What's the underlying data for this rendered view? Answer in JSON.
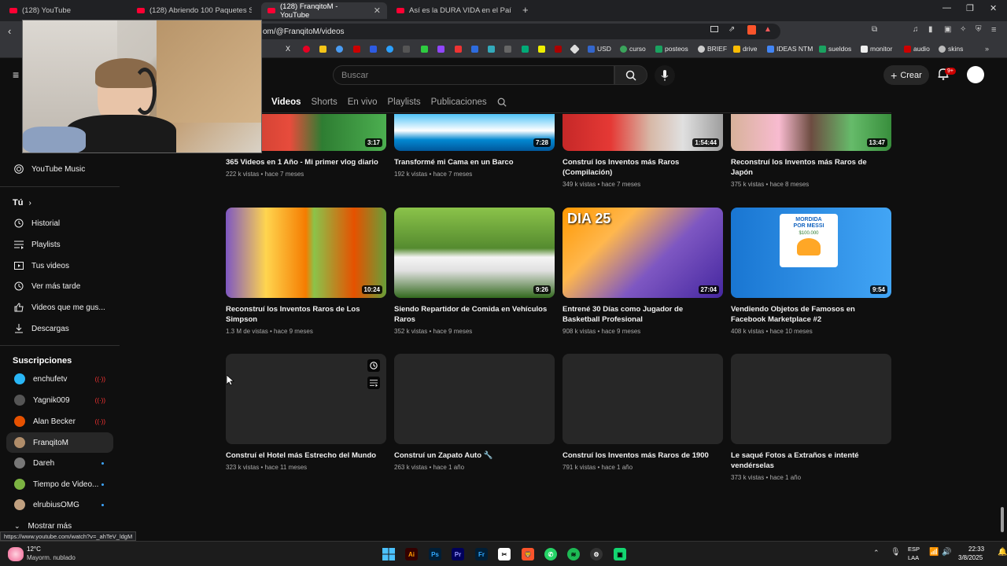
{
  "browser": {
    "tabs": [
      {
        "title": "(128) YouTube"
      },
      {
        "title": "(128) Abriendo 100 Paquetes Sorpre..."
      },
      {
        "title": "(128) FranqitoM - YouTube"
      },
      {
        "title": "Así es la DURA VIDA en el País Más B..."
      }
    ],
    "url": "om/@FranqitoM/videos",
    "bookmarks": [
      "USD",
      "curso",
      "posteos",
      "BRIEF",
      "drive",
      "IDEAS NTM",
      "sueldos",
      "monitor",
      "audio",
      "skins"
    ]
  },
  "header": {
    "search_placeholder": "Buscar",
    "create_label": "Crear",
    "notif_count": "9+"
  },
  "channel_tabs": [
    "Videos",
    "Shorts",
    "En vivo",
    "Playlists",
    "Publicaciones"
  ],
  "sidebar": {
    "music": "YouTube Music",
    "you_header": "Tú",
    "you_items": [
      "Historial",
      "Playlists",
      "Tus videos",
      "Ver más tarde",
      "Videos que me gus...",
      "Descargas"
    ],
    "subs_header": "Suscripciones",
    "subs": [
      {
        "name": "enchufetv"
      },
      {
        "name": "Yagnik009"
      },
      {
        "name": "Alan Becker"
      },
      {
        "name": "FranqitoM"
      },
      {
        "name": "Dareh"
      },
      {
        "name": "Tiempo de Video..."
      },
      {
        "name": "elrubiusOMG"
      }
    ],
    "more": "Mostrar más"
  },
  "videos": [
    {
      "title": "365 Videos en 1 Año - Mi primer vlog diario",
      "meta": "222 k vistas • hace 7 meses",
      "duration": "3:17"
    },
    {
      "title": "Transformé mi Cama en un Barco",
      "meta": "192 k vistas • hace 7 meses",
      "duration": "7:28"
    },
    {
      "title": "Construí los Inventos más Raros (Compilación)",
      "meta": "349 k vistas • hace 7 meses",
      "duration": "1:54:44"
    },
    {
      "title": "Reconstruí los Inventos más Raros de Japón",
      "meta": "375 k vistas • hace 8 meses",
      "duration": "13:47"
    },
    {
      "title": "Reconstruí los Inventos Raros de Los Simpson",
      "meta": "1.3 M de vistas • hace 9 meses",
      "duration": "10:24"
    },
    {
      "title": "Siendo Repartidor de Comida en Vehículos Raros",
      "meta": "352 k vistas • hace 9 meses",
      "duration": "9:26"
    },
    {
      "title": "Entrené 30 Días como Jugador de Basketball Profesional",
      "meta": "908 k vistas • hace 9 meses",
      "duration": "27:04",
      "overlay": "DIA 25"
    },
    {
      "title": "Vendiendo Objetos de Famosos en Facebook Marketplace #2",
      "meta": "408 k vistas • hace 10 meses",
      "duration": "9:54",
      "overlay": "MORDIDA POR MESSI",
      "overlay2": "$100.000"
    },
    {
      "title": "Construí el Hotel más Estrecho del Mundo",
      "meta": "323 k vistas • hace 11 meses"
    },
    {
      "title": "Construí un Zapato Auto 🔧",
      "meta": "263 k vistas • hace 1 año"
    },
    {
      "title": "Construí los Inventos más Raros de 1900",
      "meta": "791 k vistas • hace 1 año"
    },
    {
      "title": "Le saqué Fotos a Extraños e intenté vendérselas",
      "meta": "373 k vistas • hace 1 año"
    }
  ],
  "status_url": "https://www.youtube.com/watch?v=_ahTeV_ldgM",
  "taskbar": {
    "weather_temp": "12°C",
    "weather_desc": "Mayorm. nublado",
    "lang1": "ESP",
    "lang2": "LAA",
    "time": "22:33",
    "date": "3/8/2025"
  },
  "colors": {
    "accent": "#ff0033",
    "bg": "#0f0f0f",
    "link": "#3ea6ff"
  }
}
